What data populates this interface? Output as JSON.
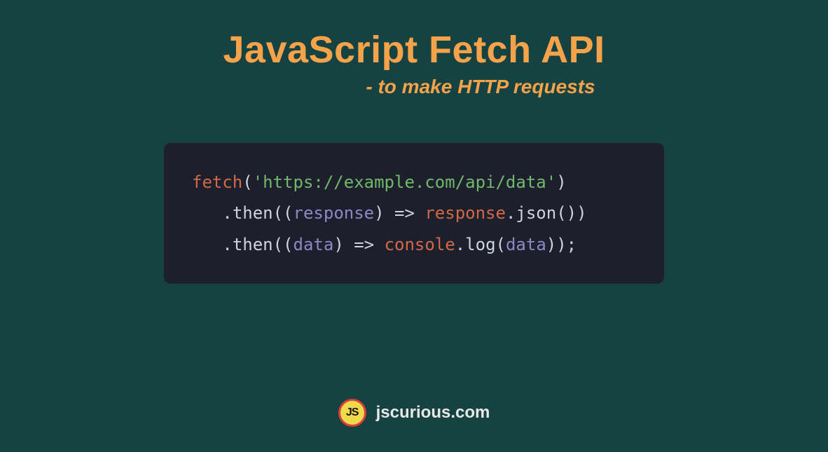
{
  "header": {
    "title": "JavaScript Fetch API",
    "subtitle": "- to make HTTP requests"
  },
  "code": {
    "fetch_fn": "fetch",
    "open": "(",
    "url": "'https://example.com/api/data'",
    "close": ")",
    "indent": "   ",
    "dot": ".",
    "then": "then",
    "lp": "((",
    "param_response": "response",
    "rp_arrow": ") => ",
    "obj_response": "response",
    "method_json": "json",
    "call": "())",
    "param_data": "data",
    "obj_console": "console",
    "method_log": "log",
    "open1": "(",
    "arg_data": "data",
    "close_stmt": "));"
  },
  "footer": {
    "logo_text": "JS",
    "site": "jscurious.com"
  }
}
